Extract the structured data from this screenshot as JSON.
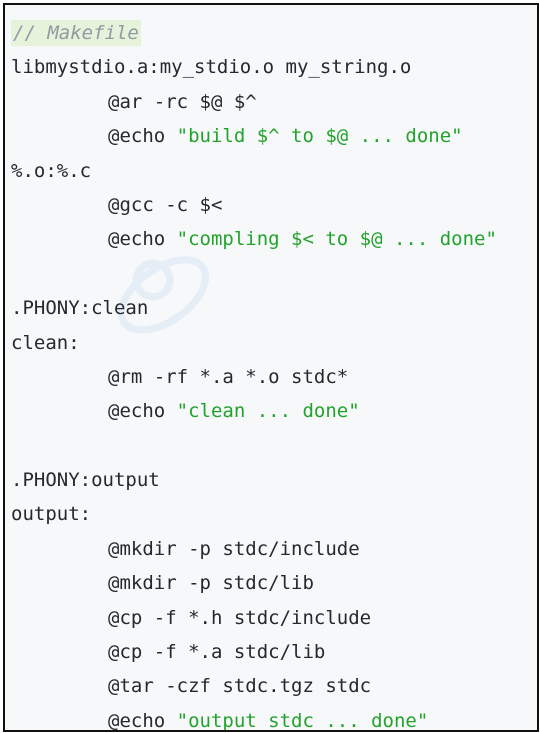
{
  "colors": {
    "border": "#111111",
    "code_background": "#f6f8fa",
    "text": "#24292e",
    "string": "#22a32c",
    "comment": "#8f9aa3",
    "comment_highlight": "#e6f3da"
  },
  "code": {
    "line1_comment": "// Makefile",
    "line2": "libmystdio.a:my_stdio.o my_string.o",
    "line3": "@ar -rc $@ $^",
    "line4_cmd": "@echo ",
    "line4_str": "\"build $^ to $@ ... done\"",
    "line5": "%.o:%.c",
    "line6": "@gcc -c $<",
    "line7_cmd": "@echo ",
    "line7_str": "\"compling $< to $@ ... done\"",
    "line9": ".PHONY:clean",
    "line10": "clean:",
    "line11": "@rm -rf *.a *.o stdc*",
    "line12_cmd": "@echo ",
    "line12_str": "\"clean ... done\"",
    "line14": ".PHONY:output",
    "line15": "output:",
    "line16": "@mkdir -p stdc/include",
    "line17": "@mkdir -p stdc/lib",
    "line18": "@cp -f *.h stdc/include",
    "line19": "@cp -f *.a stdc/lib",
    "line20": "@tar -czf stdc.tgz stdc",
    "line21_cmd": "@echo ",
    "line21_str": "\"output stdc ... done\""
  }
}
